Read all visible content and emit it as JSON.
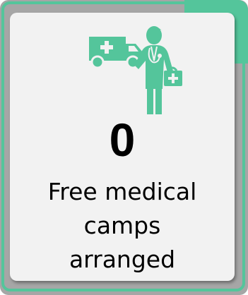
{
  "stat": {
    "value": "0",
    "label_lines": [
      "Free medical",
      "camps",
      "arranged"
    ],
    "icon": "doctor-with-ambulance-icon"
  },
  "colors": {
    "accent": "#54c59b",
    "outer_background": "#a6a6a6",
    "card_background": "#f2f2f2",
    "text": "#000000"
  }
}
